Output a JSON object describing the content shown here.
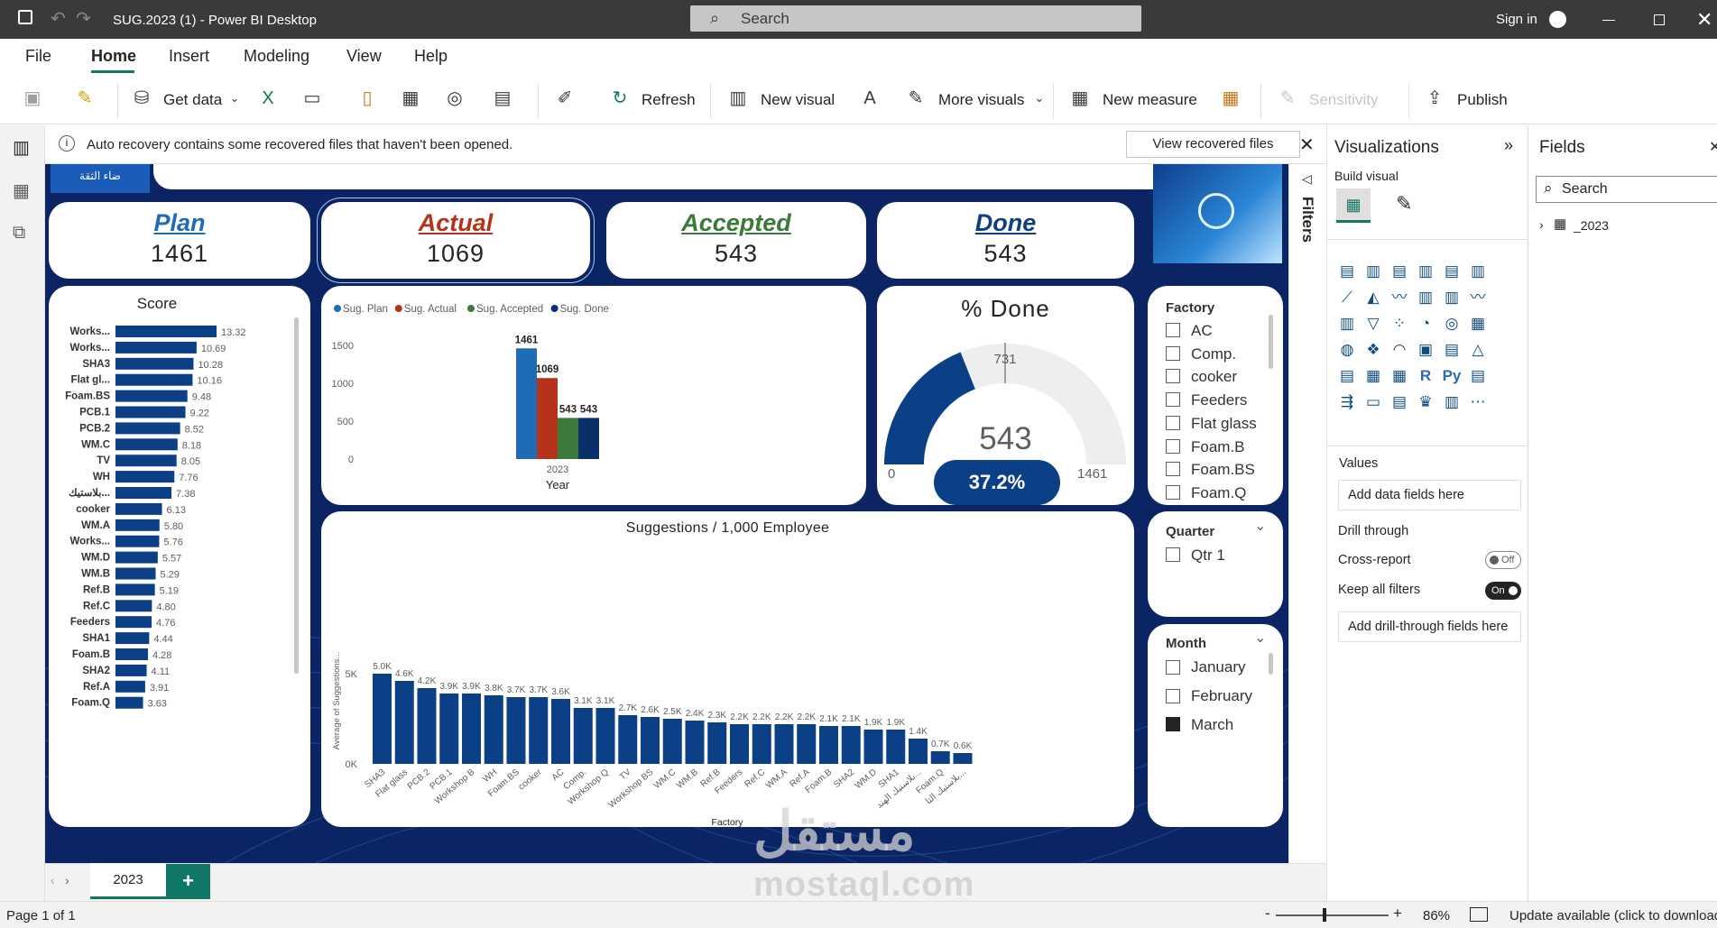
{
  "window": {
    "title": "SUG.2023 (1) - Power BI Desktop",
    "search_placeholder": "Search",
    "sign_in": "Sign in"
  },
  "menu": [
    "File",
    "Home",
    "Insert",
    "Modeling",
    "View",
    "Help"
  ],
  "ribbon": {
    "get_data": "Get data",
    "refresh": "Refresh",
    "new_visual": "New visual",
    "more_visuals": "More visuals",
    "new_measure": "New measure",
    "sensitivity": "Sensitivity",
    "publish": "Publish"
  },
  "infobar": {
    "message": "Auto recovery contains some recovered files that haven't been opened.",
    "button": "View recovered files"
  },
  "report": {
    "logo_text": "ضاء الثقة",
    "kpis": [
      {
        "title": "Plan",
        "value": "1461",
        "color": "#1f6bb5"
      },
      {
        "title": "Actual",
        "value": "1069",
        "color": "#b5331a"
      },
      {
        "title": "Accepted",
        "value": "543",
        "color": "#3c7a3a"
      },
      {
        "title": "Done",
        "value": "543",
        "color": "#0f3f82"
      }
    ],
    "score_title": "Score",
    "gauge": {
      "title": "% Done",
      "value": "543",
      "min": "0",
      "max": "1461",
      "target": "731",
      "percent": "37.2%"
    },
    "filters_label": "Filters",
    "slicers": {
      "factory": {
        "title": "Factory",
        "items": [
          "AC",
          "Comp.",
          "cooker",
          "Feeders",
          "Flat glass",
          "Foam.B",
          "Foam.BS",
          "Foam.Q"
        ]
      },
      "quarter": {
        "title": "Quarter",
        "items": [
          "Qtr 1"
        ]
      },
      "month": {
        "title": "Month",
        "items": [
          "January",
          "February",
          "March"
        ],
        "checked": [
          false,
          false,
          true
        ]
      }
    }
  },
  "chart_data": [
    {
      "type": "bar",
      "orientation": "horizontal",
      "title": "Score",
      "categories": [
        "Works...",
        "Works...",
        "SHA3",
        "Flat gl...",
        "Foam.BS",
        "PCB.1",
        "PCB.2",
        "WM.C",
        "TV",
        "WH",
        "بلاستيك...",
        "cooker",
        "WM.A",
        "Works...",
        "WM.D",
        "WM.B",
        "Ref.B",
        "Ref.C",
        "Feeders",
        "SHA1",
        "Foam.B",
        "SHA2",
        "Ref.A",
        "Foam.Q"
      ],
      "values": [
        13.32,
        10.69,
        10.28,
        10.16,
        9.48,
        9.22,
        8.52,
        8.18,
        8.05,
        7.76,
        7.38,
        6.13,
        5.8,
        5.76,
        5.57,
        5.29,
        5.19,
        4.8,
        4.76,
        4.44,
        4.28,
        4.11,
        3.91,
        3.63
      ],
      "labels": [
        "13.32",
        "10.69",
        "10.28",
        "10.16",
        "9.48",
        "9.22",
        "8.52",
        "8.18",
        "8.05",
        "7.76",
        "7.38",
        "6.13",
        "5.80",
        "5.76",
        "5.57",
        "5.29",
        "5.19",
        "4.80",
        "4.76",
        "4.44",
        "4.28",
        "4.11",
        "3.91",
        "3.63"
      ],
      "color": "#0b3f86"
    },
    {
      "type": "bar",
      "categories": [
        "2023"
      ],
      "xlabel": "Year",
      "ylim": [
        0,
        1500
      ],
      "yticks": [
        "0",
        "500",
        "1000",
        "1500"
      ],
      "series": [
        {
          "name": "Sug. Plan",
          "values": [
            1461
          ],
          "color": "#1f6bb5"
        },
        {
          "name": "Sug. Actual",
          "values": [
            1069
          ],
          "color": "#b5331a"
        },
        {
          "name": "Sug. Accepted",
          "values": [
            543
          ],
          "color": "#3c7a3a"
        },
        {
          "name": "Sug. Done",
          "values": [
            543
          ],
          "color": "#0b2f6b"
        }
      ],
      "legend": "top-left"
    },
    {
      "type": "bar",
      "title": "Suggestions / 1,000 Employee",
      "xlabel": "Factory",
      "ylabel": "Average of Suggestions...",
      "ylim": [
        0,
        5000
      ],
      "yticks": [
        "0K",
        "5K"
      ],
      "categories": [
        "SHA3",
        "Flat glass",
        "PCB.2",
        "PCB.1",
        "Workshop B",
        "WH",
        "Foam.BS",
        "cooker",
        "AC",
        "Comp.",
        "Workshop Q",
        "TV",
        "Workshop BS",
        "WM.C",
        "WM.B",
        "Ref.B",
        "Feeders",
        "Ref.C",
        "WM.A",
        "Ref.A",
        "Foam.B",
        "SHA2",
        "WM.D",
        "SHA1",
        "بلاستيك الهند...",
        "Foam.Q",
        "بلاستيك الثا..."
      ],
      "values": [
        5000,
        4600,
        4200,
        3900,
        3900,
        3800,
        3700,
        3700,
        3600,
        3100,
        3100,
        2700,
        2600,
        2500,
        2400,
        2300,
        2200,
        2200,
        2200,
        2200,
        2100,
        2100,
        1900,
        1900,
        1400,
        700,
        600
      ],
      "labels": [
        "5.0K",
        "4.6K",
        "4.2K",
        "3.9K",
        "3.9K",
        "3.8K",
        "3.7K",
        "3.7K",
        "3.6K",
        "3.1K",
        "3.1K",
        "2.7K",
        "2.6K",
        "2.5K",
        "2.4K",
        "2.3K",
        "2.2K",
        "2.2K",
        "2.2K",
        "2.2K",
        "2.1K",
        "2.1K",
        "1.9K",
        "1.9K",
        "1.4K",
        "0.7K",
        "0.6K"
      ],
      "color": "#0b3f86"
    }
  ],
  "viz_pane": {
    "title": "Visualizations",
    "build_visual": "Build visual",
    "values": "Values",
    "add_fields": "Add data fields here",
    "drill_through": "Drill through",
    "cross_report": "Cross-report",
    "cross_report_state": "Off",
    "keep_filters": "Keep all filters",
    "keep_filters_state": "On",
    "add_drill": "Add drill-through fields here"
  },
  "fields_pane": {
    "title": "Fields",
    "search_placeholder": "Search",
    "table": "_2023"
  },
  "tabs": {
    "page": "2023",
    "add": "+"
  },
  "status": {
    "page": "Page 1 of 1",
    "zoom": "86%",
    "update": "Update available (click to download)"
  },
  "watermark": {
    "arabic": "مستقل",
    "latin": "mostaql.com"
  }
}
